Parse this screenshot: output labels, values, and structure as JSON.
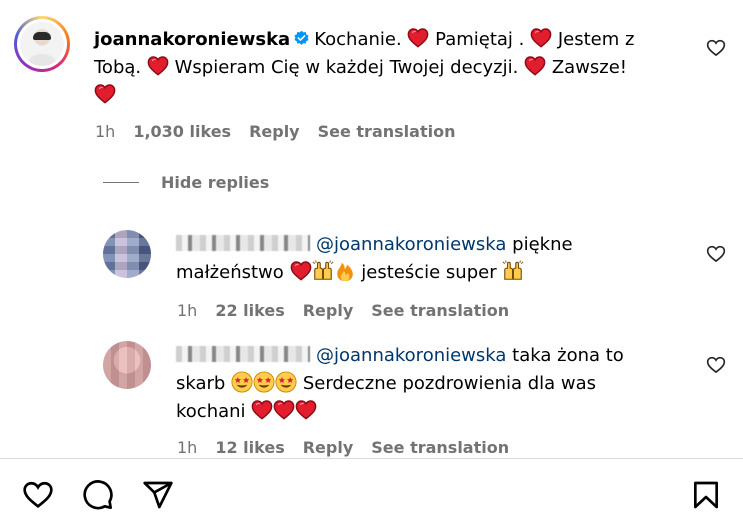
{
  "main_comment": {
    "username": "joannakoroniewska",
    "segments": [
      "Kochanie.",
      "Pamiętaj .",
      "Jestem z Tobą.",
      "Wspieram Cię w każdej Twojej decyzji.",
      "Zawsze!"
    ],
    "time": "1h",
    "likes": "1,030 likes",
    "reply": "Reply",
    "translation": "See translation"
  },
  "hide_replies": "Hide replies",
  "replies": [
    {
      "mention": "@joannakoroniewska",
      "text_a": "piękne",
      "text_b": "małżeństwo",
      "text_c": "jesteście super",
      "time": "1h",
      "likes": "22 likes",
      "reply": "Reply",
      "translation": "See translation"
    },
    {
      "mention": "@joannakoroniewska",
      "text_a": "taka żona to",
      "text_b": "skarb",
      "text_c": "Serdeczne pozdrowienia dla was",
      "text_d": "kochani",
      "time": "1h",
      "likes": "12 likes",
      "reply": "Reply",
      "translation": "See translation"
    }
  ],
  "icons": {
    "heart": "heart-icon",
    "comment": "comment-icon",
    "share": "share-icon",
    "save": "bookmark-icon",
    "heart_emoji": "red-heart-emoji",
    "hands_emoji": "raising-hands-emoji",
    "fire_emoji": "fire-emoji",
    "star_eyes_emoji": "star-struck-emoji"
  },
  "colors": {
    "mention": "#00376b",
    "muted": "#737373",
    "heart_red": "#e0245e",
    "verified_blue": "#0095f6"
  }
}
